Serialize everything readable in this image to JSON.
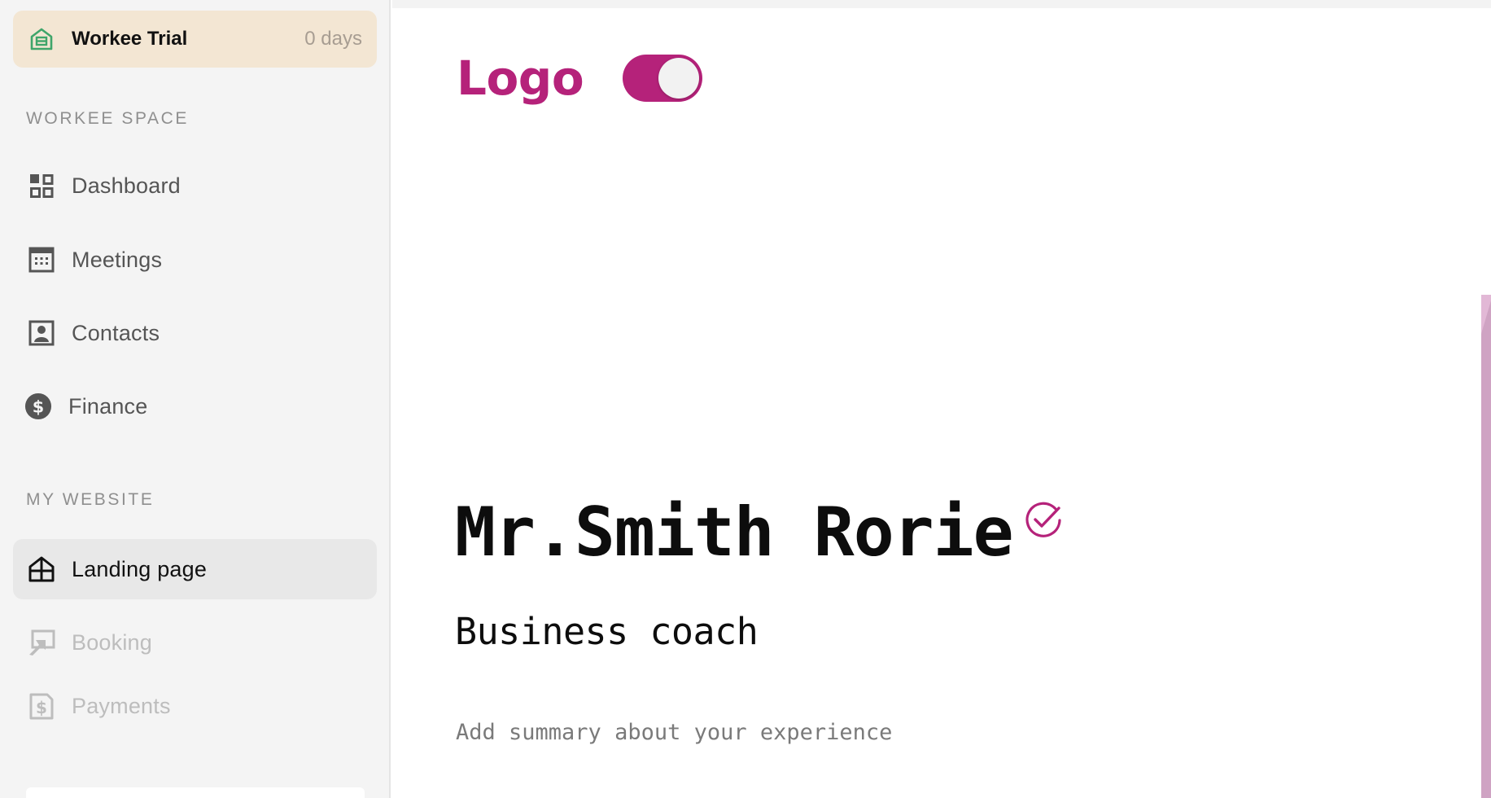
{
  "trial": {
    "title": "Workee Trial",
    "days": "0 days",
    "icon": "house-icon"
  },
  "sections": {
    "workspace": "WORKEE SPACE",
    "website": "MY WEBSITE"
  },
  "nav": {
    "dashboard": {
      "label": "Dashboard",
      "icon": "grid-icon"
    },
    "meetings": {
      "label": "Meetings",
      "icon": "calendar-icon"
    },
    "contacts": {
      "label": "Contacts",
      "icon": "contact-card-icon"
    },
    "finance": {
      "label": "Finance",
      "icon": "dollar-icon"
    },
    "landing": {
      "label": "Landing page",
      "icon": "home-icon",
      "active": true
    },
    "booking": {
      "label": "Booking",
      "icon": "booking-icon",
      "disabled": true
    },
    "payments": {
      "label": "Payments",
      "icon": "payment-doc-icon",
      "disabled": true
    }
  },
  "main": {
    "logo_text": "Logo",
    "logo_toggle_on": true,
    "name": "Mr.Smith Rorie",
    "role": "Business coach",
    "summary_placeholder": "Add summary about your experience"
  },
  "colors": {
    "accent": "#b5227a",
    "trial_bg": "#f3e6d3",
    "sidebar_bg": "#f4f4f4",
    "trial_icon": "#3fa56a",
    "muted": "#8f8f8f"
  }
}
